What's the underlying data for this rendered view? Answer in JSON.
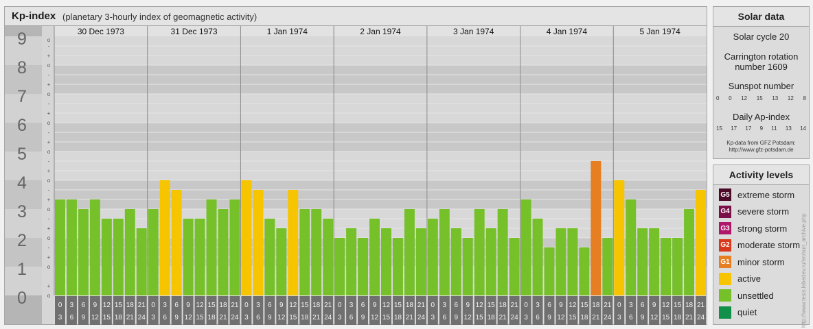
{
  "main": {
    "title": "Kp-index",
    "subtitle": "(planetary 3-hourly index of geomagnetic activity)"
  },
  "chart_data": {
    "type": "bar",
    "ylim": [
      0,
      9
    ],
    "y_ticks": [
      "0",
      "1",
      "2",
      "3",
      "4",
      "5",
      "6",
      "7",
      "8",
      "9"
    ],
    "minor_markers": [
      "+",
      "o",
      "-"
    ],
    "days": [
      "30 Dec 1973",
      "31 Dec 1973",
      "1 Jan 1974",
      "2 Jan 1974",
      "3 Jan 1974",
      "4 Jan 1974",
      "5 Jan 1974"
    ],
    "interval_start": [
      "0",
      "3",
      "6",
      "9",
      "12",
      "15",
      "18",
      "21"
    ],
    "interval_end": [
      "3",
      "6",
      "9",
      "12",
      "15",
      "18",
      "21",
      "24"
    ],
    "values": [
      3.333,
      3.333,
      3,
      3.333,
      2.667,
      2.667,
      3,
      2.333,
      3,
      4,
      3.667,
      2.667,
      2.667,
      3.333,
      3,
      3.333,
      4,
      3.667,
      2.667,
      2.333,
      3.667,
      3,
      3,
      2.667,
      2,
      2.333,
      2,
      2.667,
      2.333,
      2,
      3,
      2.333,
      2.667,
      3,
      2.333,
      2,
      3,
      2.333,
      3,
      2,
      3.333,
      2.667,
      1.667,
      2.333,
      2.333,
      1.667,
      4.667,
      2,
      4,
      3.333,
      2.333,
      2.333,
      2,
      2,
      3,
      3.667
    ],
    "categories_color": {
      "unsettled": "#76c12a",
      "active": "#f7c400",
      "minor_storm": "#e67e22"
    }
  },
  "solar": {
    "title": "Solar data",
    "cycle": "Solar cycle 20",
    "carrington_line1": "Carrington rotation",
    "carrington_line2": "number 1609",
    "sunspot_label": "Sunspot number",
    "sunspot_values": [
      "0",
      "0",
      "12",
      "15",
      "13",
      "12",
      "8"
    ],
    "ap_label": "Daily Ap-index",
    "ap_values": [
      "15",
      "17",
      "17",
      "9",
      "11",
      "13",
      "14"
    ],
    "source_line1": "Kp-data from GFZ Potsdam:",
    "source_line2": "http://www.gfz-potsdam.de"
  },
  "activity": {
    "title": "Activity levels",
    "levels": [
      {
        "code": "G5",
        "label": "extreme storm",
        "color": "#4a0a28"
      },
      {
        "code": "G4",
        "label": "severe storm",
        "color": "#7a1048"
      },
      {
        "code": "G3",
        "label": "strong storm",
        "color": "#b0166a"
      },
      {
        "code": "G2",
        "label": "moderate storm",
        "color": "#d8391c"
      },
      {
        "code": "G1",
        "label": "minor storm",
        "color": "#e67e22"
      },
      {
        "code": "",
        "label": "active",
        "color": "#f7c400"
      },
      {
        "code": "",
        "label": "unsettled",
        "color": "#76c12a"
      },
      {
        "code": "",
        "label": "quiet",
        "color": "#109048"
      }
    ]
  },
  "watermark": "http://www.tesis.lebedev.ru/en/sun_archive.php"
}
